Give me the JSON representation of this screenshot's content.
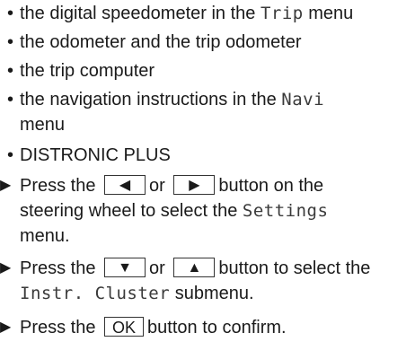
{
  "bullets": {
    "b1": {
      "before": "the digital speedometer in the ",
      "menu": "Trip",
      "after": " menu"
    },
    "b2": "the odometer and the trip odometer",
    "b3": "the trip computer",
    "b4": {
      "before": "the navigation instructions in the ",
      "menu": "Navi",
      "after_line2": "menu"
    },
    "b5": "DISTRONIC PLUS"
  },
  "steps": {
    "s1": {
      "press": "Press the",
      "key_left": "◀",
      "or": "or",
      "key_right": "▶",
      "after": "button on the",
      "line2": "steering wheel to select the ",
      "menu": "Settings",
      "line3": "menu."
    },
    "s2": {
      "press": "Press the",
      "key_down": "▼",
      "or": "or",
      "key_up": "▲",
      "after": "button to select the",
      "submenu": "Instr. Cluster",
      "submenu_after": " submenu."
    },
    "s3": {
      "press": "Press the",
      "key_ok": "OK",
      "after": "button to confirm."
    }
  },
  "glyphs": {
    "bullet": "•",
    "step_marker": "▶"
  }
}
